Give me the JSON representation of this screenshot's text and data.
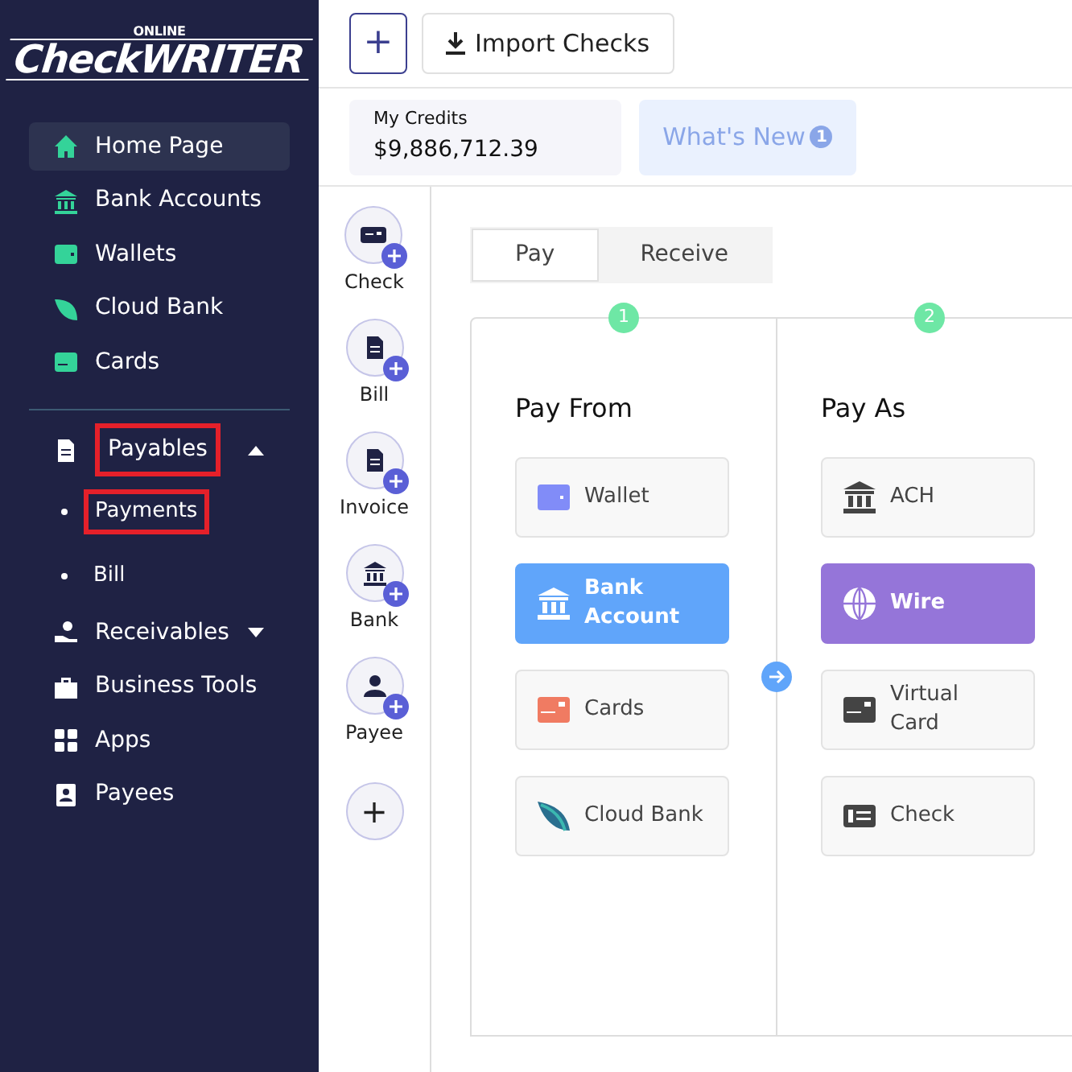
{
  "logo": {
    "top": "ONLINE",
    "main": "CheckWRITER"
  },
  "sidebar": {
    "items": [
      {
        "label": "Home Page",
        "selected": true,
        "highlighted": false
      },
      {
        "label": "Bank Accounts",
        "selected": false,
        "highlighted": false
      },
      {
        "label": "Wallets",
        "selected": false,
        "highlighted": false
      },
      {
        "label": "Cloud Bank",
        "selected": false,
        "highlighted": false
      },
      {
        "label": "Cards",
        "selected": false,
        "highlighted": false
      },
      {
        "label": "Payables",
        "selected": false,
        "highlighted": true,
        "expanded": true,
        "children": [
          {
            "label": "Payments",
            "highlighted": true
          },
          {
            "label": "Bill",
            "highlighted": false
          }
        ]
      },
      {
        "label": "Receivables",
        "selected": false,
        "highlighted": false,
        "expanded": false
      },
      {
        "label": "Business Tools",
        "selected": false,
        "highlighted": false
      },
      {
        "label": "Apps",
        "selected": false,
        "highlighted": false
      },
      {
        "label": "Payees",
        "selected": false,
        "highlighted": false
      }
    ]
  },
  "toolbar": {
    "add": "+",
    "import": "Import Checks"
  },
  "credits": {
    "label": "My Credits",
    "value": "$9,886,712.39"
  },
  "whats_new": {
    "label": "What's New",
    "badge": "1"
  },
  "quick_add": [
    "Check",
    "Bill",
    "Invoice",
    "Bank",
    "Payee"
  ],
  "quick_add_more": "+",
  "tabs": [
    {
      "label": "Pay",
      "selected": true
    },
    {
      "label": "Receive",
      "selected": false
    }
  ],
  "steps": [
    {
      "number": "1",
      "title": "Pay From",
      "color": "#60a5fa",
      "options": [
        {
          "label": "Wallet",
          "selected": false
        },
        {
          "label": "Bank Account",
          "selected": true
        },
        {
          "label": "Cards",
          "selected": false
        },
        {
          "label": "Cloud Bank",
          "selected": false
        }
      ]
    },
    {
      "number": "2",
      "title": "Pay As",
      "color": "#9575d9",
      "options": [
        {
          "label": "ACH",
          "selected": false
        },
        {
          "label": "Wire",
          "selected": true
        },
        {
          "label": "Virtual Card",
          "selected": false
        },
        {
          "label": "Check",
          "selected": false
        }
      ]
    }
  ]
}
